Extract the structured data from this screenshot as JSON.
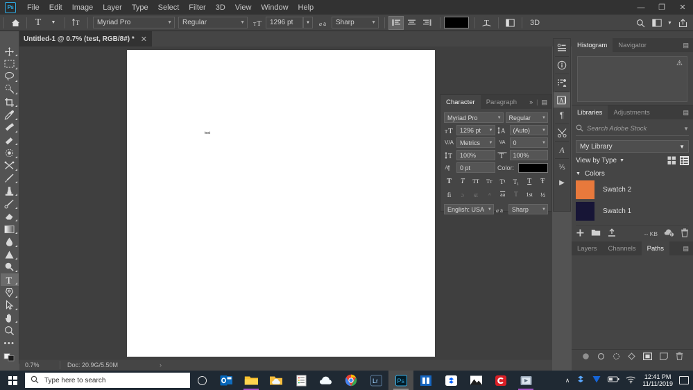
{
  "app": {
    "name": "Adobe Photoshop",
    "logo_text": "Ps"
  },
  "menubar": {
    "items": [
      {
        "label": "File"
      },
      {
        "label": "Edit"
      },
      {
        "label": "Image"
      },
      {
        "label": "Layer"
      },
      {
        "label": "Type"
      },
      {
        "label": "Select"
      },
      {
        "label": "Filter"
      },
      {
        "label": "3D"
      },
      {
        "label": "View"
      },
      {
        "label": "Window"
      },
      {
        "label": "Help"
      }
    ],
    "window_controls": {
      "minimize": "—",
      "restore": "❐",
      "close": "✕"
    }
  },
  "options_bar": {
    "home_icon": "home-icon",
    "tool_icon": "T",
    "orientation_icon": "text-orientation-icon",
    "font_family": "Myriad Pro",
    "font_style": "Regular",
    "size_icon": "font-size-icon",
    "font_size": "1296 pt",
    "aa_icon": "anti-alias-icon",
    "anti_alias": "Sharp",
    "align_left": "align-left-icon",
    "align_center": "align-center-icon",
    "align_right": "align-right-icon",
    "text_color": "#000000",
    "warp_icon": "warp-text-icon",
    "panels_icon": "toggle-panels-icon",
    "three_d_label": "3D",
    "search_icon": "search-icon",
    "workspace_icon": "workspace-icon",
    "share_icon": "share-icon"
  },
  "document": {
    "tab_title": "Untitled-1 @ 0.7% (test, RGB/8#) *",
    "close_glyph": "✕",
    "canvas_text": "test"
  },
  "toolbar": {
    "tools": [
      {
        "name": "move-tool",
        "label": "Move Tool"
      },
      {
        "name": "marquee-tool",
        "label": "Rectangular Marquee Tool"
      },
      {
        "name": "lasso-tool",
        "label": "Lasso Tool"
      },
      {
        "name": "quick-selection-tool",
        "label": "Quick Selection Tool"
      },
      {
        "name": "crop-tool",
        "label": "Crop Tool"
      },
      {
        "name": "eyedropper-tool",
        "label": "Eyedropper Tool"
      },
      {
        "name": "spot-healing-brush-tool",
        "label": "Spot Healing Brush Tool"
      },
      {
        "name": "patch-tool",
        "label": "Patch Tool"
      },
      {
        "name": "blur-tool",
        "label": "Blur Tool"
      },
      {
        "name": "shuffle-tool",
        "label": "Shuffle Tool"
      },
      {
        "name": "brush-tool",
        "label": "Brush Tool"
      },
      {
        "name": "clone-stamp-tool",
        "label": "Clone Stamp Tool"
      },
      {
        "name": "history-brush-tool",
        "label": "History Brush Tool"
      },
      {
        "name": "eraser-tool",
        "label": "Eraser Tool"
      },
      {
        "name": "gradient-tool",
        "label": "Gradient Tool"
      },
      {
        "name": "blur-drop-tool",
        "label": "Blur Tool"
      },
      {
        "name": "dodge-tool",
        "label": "Dodge Tool"
      },
      {
        "name": "sponge-tool",
        "label": "Sponge Tool"
      },
      {
        "name": "type-tool",
        "label": "Horizontal Type Tool",
        "active": true
      },
      {
        "name": "pen-tool",
        "label": "Pen Tool"
      },
      {
        "name": "path-selection-tool",
        "label": "Path Selection Tool"
      },
      {
        "name": "hand-tool",
        "label": "Hand Tool"
      },
      {
        "name": "zoom-tool",
        "label": "Zoom Tool"
      },
      {
        "name": "edit-toolbar-tool",
        "label": "Edit Toolbar"
      }
    ]
  },
  "status_bar": {
    "zoom": "0.7%",
    "doc_info": "Doc: 20.9G/5.50M",
    "arrow": "›"
  },
  "character_panel": {
    "tabs": [
      {
        "label": "Character",
        "active": true
      },
      {
        "label": "Paragraph",
        "active": false
      }
    ],
    "collapse_glyph": "»",
    "menu_glyph": "▤",
    "font_family": "Myriad Pro",
    "font_style": "Regular",
    "font_size": "1296 pt",
    "leading": "(Auto)",
    "kerning": "Metrics",
    "tracking": "0",
    "vertical_scale": "100%",
    "horizontal_scale": "100%",
    "baseline_shift": "0 pt",
    "color_label": "Color:",
    "color": "#000000",
    "styles_row1": [
      "T",
      "T",
      "TT",
      "Tт",
      "T¹",
      "T₁",
      "T",
      "Ŧ"
    ],
    "styles_row2": [
      "fi",
      "ɔ",
      "st",
      "ᴬ",
      "aa",
      "T",
      "1st",
      "½"
    ],
    "language": "English: USA",
    "aa_icon": "anti-alias-icon",
    "anti_alias": "Sharp"
  },
  "icon_dock": {
    "items": [
      {
        "name": "properties-icon",
        "glyph": "≡"
      },
      {
        "name": "info-icon",
        "glyph": "ⓘ"
      },
      {
        "name": "layer-comps-icon",
        "glyph": "☰"
      },
      {
        "name": "character-panel-icon",
        "glyph": "A",
        "active": true
      },
      {
        "name": "paragraph-panel-icon",
        "glyph": "¶"
      },
      {
        "name": "tool-presets-icon",
        "glyph": "✂"
      },
      {
        "name": "glyphs-icon",
        "glyph": "𝒜"
      },
      {
        "name": "character-styles-icon",
        "glyph": "Ⅳ"
      },
      {
        "name": "actions-icon",
        "glyph": "▶"
      }
    ]
  },
  "histogram_panel": {
    "tabs": [
      {
        "label": "Histogram",
        "active": true
      },
      {
        "label": "Navigator",
        "active": false
      }
    ],
    "menu_glyph": "▤",
    "warning_glyph": "⚠"
  },
  "libraries_panel": {
    "tabs": [
      {
        "label": "Libraries",
        "active": true
      },
      {
        "label": "Adjustments",
        "active": false
      }
    ],
    "menu_glyph": "▤",
    "search_icon": "search-icon",
    "search_placeholder": "Search Adobe Stock",
    "library_name": "My Library",
    "view_label": "View by Type",
    "grid_view_icon": "grid-view-icon",
    "list_view_icon": "list-view-icon",
    "group_label": "Colors",
    "swatches": [
      {
        "label": "Swatch 2",
        "color": "#e8793c"
      },
      {
        "label": "Swatch 1",
        "color": "#171536"
      }
    ],
    "footer": {
      "add_icon": "add-icon",
      "folder_icon": "folder-icon",
      "upload_icon": "upload-icon",
      "size_label": "-- KB",
      "sync_icon": "cloud-sync-icon",
      "delete_icon": "trash-icon"
    }
  },
  "paths_panel": {
    "tabs": [
      {
        "label": "Layers",
        "active": false
      },
      {
        "label": "Channels",
        "active": false
      },
      {
        "label": "Paths",
        "active": true
      }
    ],
    "menu_glyph": "▤",
    "footer_icons": [
      {
        "name": "fill-path-icon"
      },
      {
        "name": "stroke-path-icon"
      },
      {
        "name": "load-selection-icon"
      },
      {
        "name": "make-work-path-icon"
      },
      {
        "name": "add-mask-icon"
      },
      {
        "name": "new-path-icon"
      },
      {
        "name": "delete-path-icon"
      }
    ]
  },
  "taskbar": {
    "start_icon": "windows-start-icon",
    "search_icon": "search-icon",
    "search_placeholder": "Type here to search",
    "cortana_icon": "cortana-icon",
    "apps": [
      {
        "name": "taskview-icon",
        "label": ""
      },
      {
        "name": "outlook-icon",
        "label": "o"
      },
      {
        "name": "file-explorer-icon",
        "label": ""
      },
      {
        "name": "onedrive-folder-icon",
        "label": ""
      },
      {
        "name": "sticky-notes-icon",
        "label": ""
      },
      {
        "name": "onedrive-icon",
        "label": ""
      },
      {
        "name": "chrome-icon",
        "label": ""
      },
      {
        "name": "lightroom-icon",
        "label": "Lr"
      },
      {
        "name": "photoshop-icon",
        "label": "Ps",
        "active": true
      },
      {
        "name": "bridge-icon",
        "label": ""
      },
      {
        "name": "dropbox-icon",
        "label": ""
      },
      {
        "name": "photos-icon",
        "label": ""
      },
      {
        "name": "creative-cloud-icon",
        "label": ""
      },
      {
        "name": "media-player-icon",
        "label": ""
      }
    ],
    "tray": {
      "chevron": "∧",
      "dropbox_icon": "dropbox-tray-icon",
      "v_icon": "v-tray-icon",
      "battery_icon": "battery-icon",
      "wifi_icon": "wifi-icon",
      "time": "12:41 PM",
      "date": "11/11/2019",
      "notifications_icon": "notifications-icon"
    }
  }
}
